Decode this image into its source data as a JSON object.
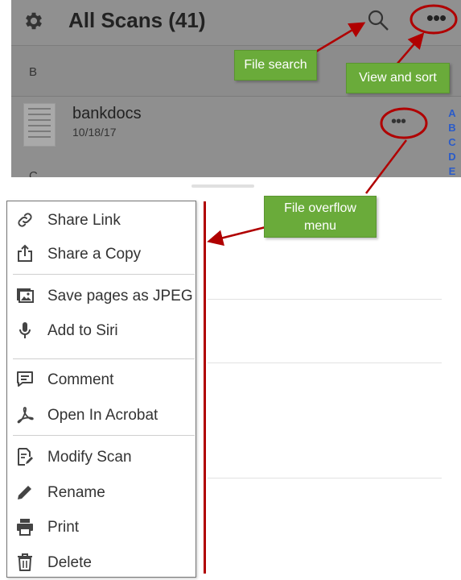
{
  "header": {
    "title": "All Scans (41)",
    "settings_icon": "gear-icon",
    "search_icon": "search-icon",
    "more_icon": "ellipsis-icon",
    "more_glyph": "•••"
  },
  "sections": {
    "b": "B",
    "c": "C"
  },
  "file": {
    "name": "bankdocs",
    "date": "10/18/17",
    "more_glyph": "•••"
  },
  "alphabet_index": [
    "A",
    "B",
    "C",
    "D",
    "E"
  ],
  "menu": {
    "items": [
      {
        "label": "Share Link",
        "icon": "link-icon"
      },
      {
        "label": "Share a Copy",
        "icon": "share-icon"
      },
      {
        "label": "Save pages as JPEG",
        "icon": "image-icon"
      },
      {
        "label": "Add to Siri",
        "icon": "microphone-icon"
      },
      {
        "label": "Comment",
        "icon": "comment-icon"
      },
      {
        "label": "Open In Acrobat",
        "icon": "acrobat-icon"
      },
      {
        "label": "Modify Scan",
        "icon": "edit-document-icon"
      },
      {
        "label": "Rename",
        "icon": "pencil-icon"
      },
      {
        "label": "Print",
        "icon": "printer-icon"
      },
      {
        "label": "Delete",
        "icon": "trash-icon"
      }
    ]
  },
  "annotations": {
    "file_search": "File search",
    "view_and_sort": "View and sort",
    "file_overflow_line1": "File overflow",
    "file_overflow_line2": "menu"
  },
  "colors": {
    "accent_red": "#b00000",
    "callout_green": "#6aab3a",
    "index_blue": "#2a5bc9"
  }
}
